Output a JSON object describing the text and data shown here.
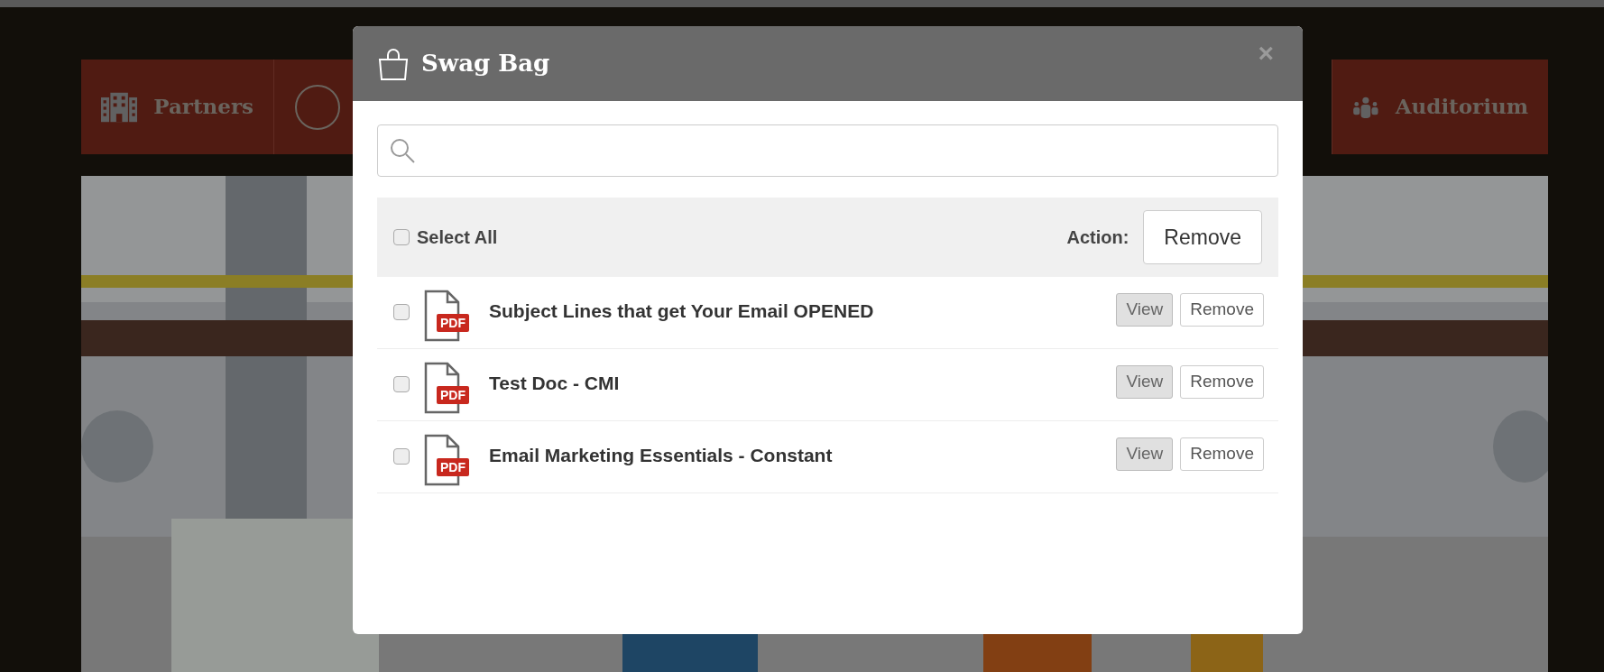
{
  "nav": [
    {
      "kind": "building",
      "label": "Partners"
    },
    {
      "kind": "circle"
    },
    {
      "kind": "people",
      "label": "Auditorium"
    }
  ],
  "modal": {
    "title": "Swag Bag",
    "close": "×",
    "toolbar": {
      "select_all": {
        "label": "Select All",
        "checked": false
      },
      "action_label": "Action:",
      "action_button": "Remove"
    },
    "items": [
      {
        "title": "Subject Lines that get Your Email OPENED",
        "badge": "PDF",
        "checked": false,
        "view": "View",
        "remove": "Remove"
      },
      {
        "title": "Test Doc - CMI",
        "badge": "PDF",
        "checked": false,
        "view": "View",
        "remove": "Remove"
      },
      {
        "title": "Email Marketing Essentials - Constant",
        "badge": "PDF",
        "checked": false,
        "view": "View",
        "remove": "Remove"
      }
    ]
  }
}
